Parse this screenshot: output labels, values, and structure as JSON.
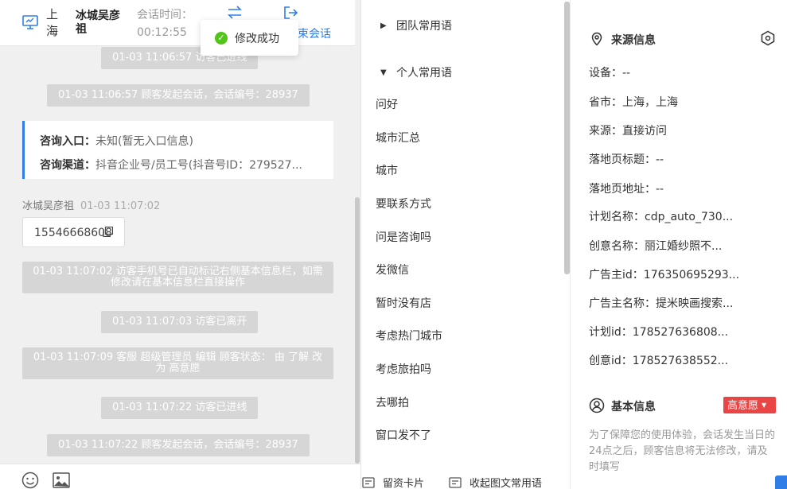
{
  "header": {
    "city": "上海",
    "visitor_name": "冰城吴彦祖",
    "session_time_label": "会话时间：",
    "session_time": "00:12:55",
    "end_session_label": "束会话"
  },
  "toast": {
    "message": "修改成功"
  },
  "chat": {
    "system_messages": [
      "01-03 11:06:57 访客已进线",
      "01-03 11:06:57 顾客发起会话，会话编号：28937"
    ],
    "consult_card": {
      "entry_label": "咨询入口：",
      "entry_value": "未知(暂无入口信息)",
      "channel_label": "咨询渠道：",
      "channel_value": "抖音企业号/员工号(抖音号ID：279527..."
    },
    "message": {
      "sender": "冰城吴彦祖",
      "time": "01-03 11:07:02",
      "text": "15546668608"
    },
    "system_messages_2": [
      "01-03 11:07:02 访客手机号已自动标记右侧基本信息栏，如需修改请在基本信息栏直接操作",
      "01-03 11:07:03 访客已离开",
      "01-03 11:07:09 客服 超级管理员 编辑 顾客状态： 由 了解 改为 高意愿",
      "01-03 11:07:22 访客已进线",
      "01-03 11:07:22 顾客发起会话，会话编号：28937"
    ]
  },
  "phrases": {
    "team_group": "团队常用语",
    "personal_group": "个人常用语",
    "items": [
      "问好",
      "城市汇总",
      "城市",
      "要联系方式",
      "问是咨询吗",
      "发微信",
      "暂时没有店",
      "考虑热门城市",
      "考虑旅拍吗",
      "去哪拍",
      "窗口发不了"
    ],
    "footer": {
      "card_label": "留资卡片",
      "collapse_label": "收起图文常用语"
    }
  },
  "info": {
    "source_title": "来源信息",
    "fields": [
      {
        "label": "设备：",
        "value": "--"
      },
      {
        "label": "省市：",
        "value": "上海，上海"
      },
      {
        "label": "来源：",
        "value": "直接访问"
      },
      {
        "label": "落地页标题：",
        "value": "--"
      },
      {
        "label": "落地页地址：",
        "value": "--"
      },
      {
        "label": "计划名称：",
        "value": "cdp_auto_730..."
      },
      {
        "label": "创意名称：",
        "value": "丽江婚纱照不..."
      },
      {
        "label": "广告主id：",
        "value": "176350695293..."
      },
      {
        "label": "广告主名称：",
        "value": "提米映画搜索..."
      },
      {
        "label": "计划id：",
        "value": "178527636808..."
      },
      {
        "label": "创意id：",
        "value": "178527638552..."
      }
    ],
    "basic_title": "基本信息",
    "intent_badge": "高意愿",
    "note": "为了保障您的使用体验，会话发生当日的24点之后，顾客信息将无法修改，请及时填写"
  },
  "colors": {
    "accent": "#2f7ee8",
    "danger": "#e94545",
    "success": "#52c41a"
  }
}
